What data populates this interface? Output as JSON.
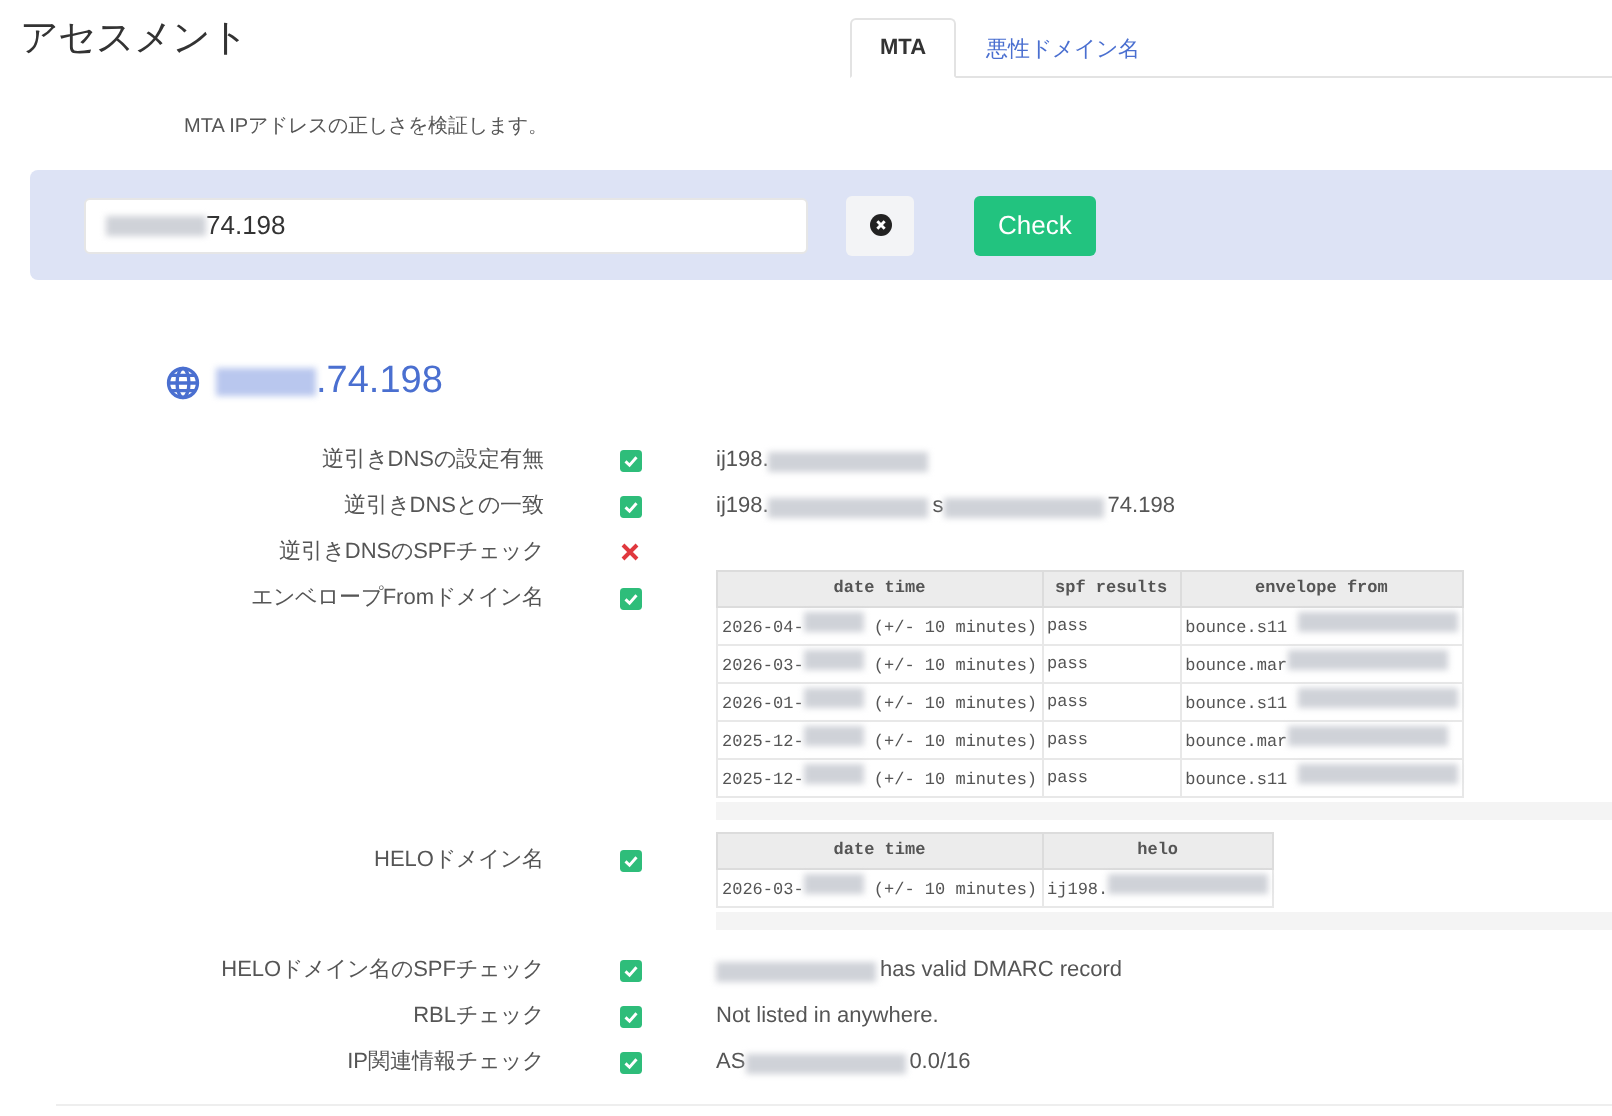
{
  "title": "アセスメント",
  "tabs": [
    {
      "label": "MTA",
      "selected": true
    },
    {
      "label": "悪性ドメイン名",
      "selected": false
    }
  ],
  "description": "MTA IPアドレスの正しさを検証します。",
  "search": {
    "value": [
      {
        "kind": "redacted"
      },
      {
        "kind": "text",
        "text": "74.198"
      }
    ],
    "check_label": "Check"
  },
  "host": [
    {
      "kind": "redacted"
    },
    {
      "kind": "text",
      "text": ".74.198"
    }
  ],
  "checks": [
    {
      "label": "逆引きDNSの設定有無",
      "ok": true,
      "kind": "text",
      "parts": [
        {
          "kind": "text",
          "text": "ij198."
        },
        {
          "kind": "redacted"
        }
      ]
    },
    {
      "label": "逆引きDNSとの一致",
      "ok": true,
      "kind": "text",
      "parts": [
        {
          "kind": "text",
          "text": "ij198."
        },
        {
          "kind": "redacted"
        },
        {
          "kind": "text",
          "text": "s "
        },
        {
          "kind": "redacted"
        },
        {
          "kind": "text",
          "text": "74.198"
        }
      ]
    },
    {
      "label": "逆引きDNSのSPFチェック",
      "ok": false,
      "kind": "none"
    },
    {
      "label": "エンベロープFromドメイン名",
      "ok": true,
      "kind": "table",
      "columns": [
        "date time",
        "spf results",
        "envelope from"
      ],
      "rows": [
        [
          [
            {
              "kind": "text",
              "text": "2026-04-"
            },
            {
              "kind": "redacted"
            },
            {
              "kind": "text",
              "text": " (+/- 10 minutes)"
            }
          ],
          [
            {
              "kind": "text",
              "text": "pass"
            }
          ],
          [
            {
              "kind": "text",
              "text": "bounce.s11 "
            },
            {
              "kind": "redacted"
            }
          ]
        ],
        [
          [
            {
              "kind": "text",
              "text": "2026-03-"
            },
            {
              "kind": "redacted"
            },
            {
              "kind": "text",
              "text": " (+/- 10 minutes)"
            }
          ],
          [
            {
              "kind": "text",
              "text": "pass"
            }
          ],
          [
            {
              "kind": "text",
              "text": "bounce.mar"
            },
            {
              "kind": "redacted"
            }
          ]
        ],
        [
          [
            {
              "kind": "text",
              "text": "2026-01-"
            },
            {
              "kind": "redacted"
            },
            {
              "kind": "text",
              "text": " (+/- 10 minutes)"
            }
          ],
          [
            {
              "kind": "text",
              "text": "pass"
            }
          ],
          [
            {
              "kind": "text",
              "text": "bounce.s11 "
            },
            {
              "kind": "redacted"
            }
          ]
        ],
        [
          [
            {
              "kind": "text",
              "text": "2025-12-"
            },
            {
              "kind": "redacted"
            },
            {
              "kind": "text",
              "text": " (+/- 10 minutes)"
            }
          ],
          [
            {
              "kind": "text",
              "text": "pass"
            }
          ],
          [
            {
              "kind": "text",
              "text": "bounce.mar"
            },
            {
              "kind": "redacted"
            }
          ]
        ],
        [
          [
            {
              "kind": "text",
              "text": "2025-12-"
            },
            {
              "kind": "redacted"
            },
            {
              "kind": "text",
              "text": " (+/- 10 minutes)"
            }
          ],
          [
            {
              "kind": "text",
              "text": "pass"
            }
          ],
          [
            {
              "kind": "text",
              "text": "bounce.s11 "
            },
            {
              "kind": "redacted"
            }
          ]
        ]
      ]
    },
    {
      "label": "HELOドメイン名",
      "ok": true,
      "kind": "table",
      "columns": [
        "date time",
        "helo"
      ],
      "rows": [
        [
          [
            {
              "kind": "text",
              "text": "2026-03-"
            },
            {
              "kind": "redacted"
            },
            {
              "kind": "text",
              "text": " (+/- 10 minutes)"
            }
          ],
          [
            {
              "kind": "text",
              "text": "ij198."
            },
            {
              "kind": "redacted"
            }
          ]
        ]
      ]
    },
    {
      "label": "HELOドメイン名のSPFチェック",
      "ok": true,
      "kind": "text",
      "parts": [
        {
          "kind": "redacted"
        },
        {
          "kind": "text",
          "text": "has valid DMARC record"
        }
      ]
    },
    {
      "label": "RBLチェック",
      "ok": true,
      "kind": "text",
      "parts": [
        {
          "kind": "text",
          "text": "Not listed in anywhere."
        }
      ]
    },
    {
      "label": "IP関連情報チェック",
      "ok": true,
      "kind": "text",
      "parts": [
        {
          "kind": "text",
          "text": "AS"
        },
        {
          "kind": "redacted"
        },
        {
          "kind": "text",
          "text": "0.0/16"
        }
      ]
    }
  ]
}
